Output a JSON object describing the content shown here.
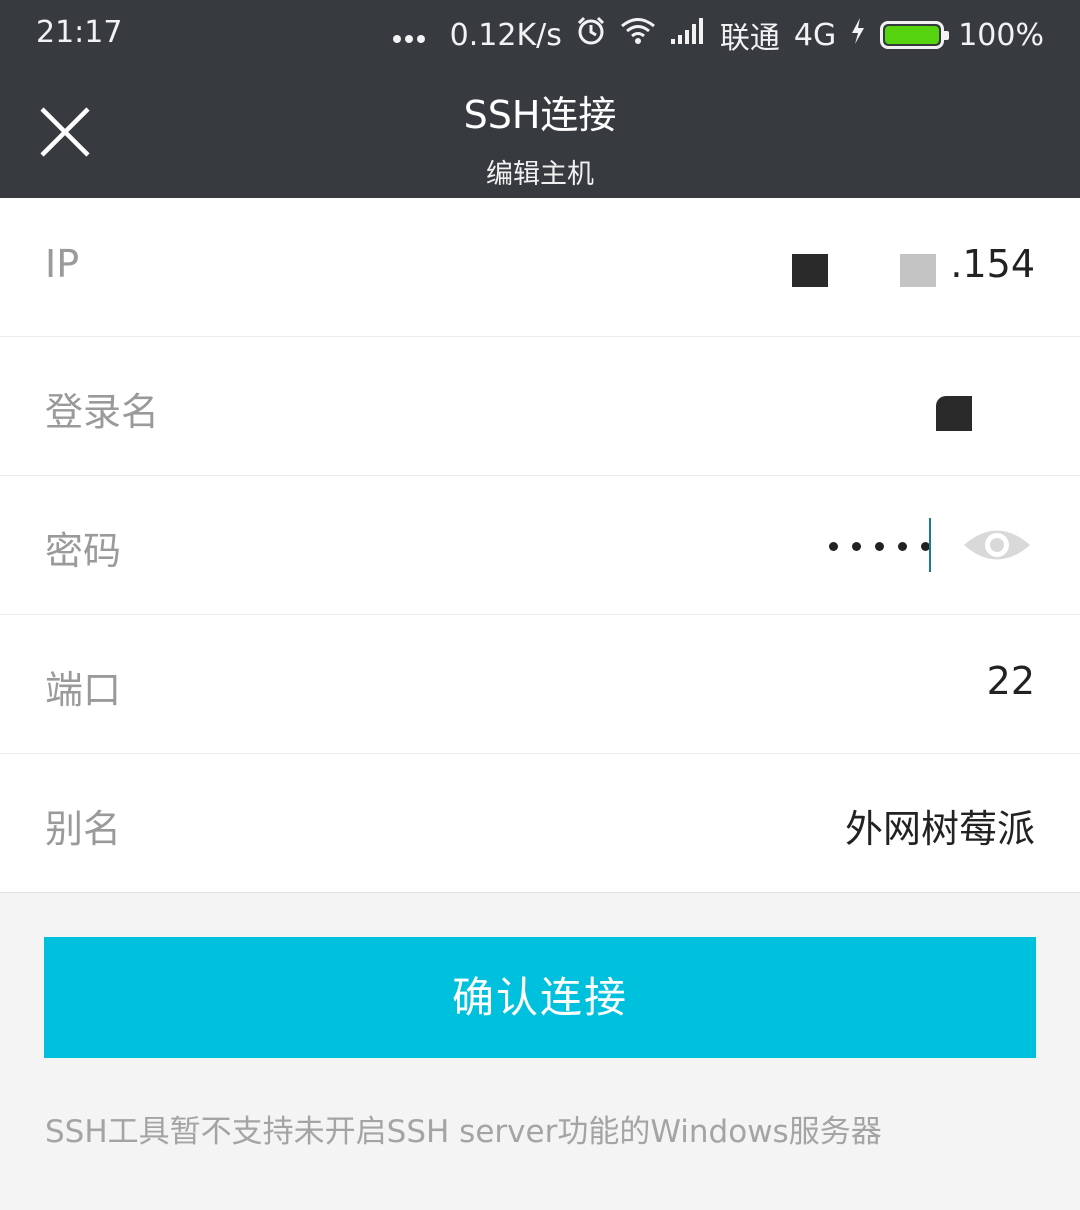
{
  "status_bar": {
    "time": "21:17",
    "net_speed": "0.12K/s",
    "carrier": "联通",
    "network": "4G",
    "battery": "100%",
    "battery_level": 1.0,
    "icons": [
      "more-dots-icon",
      "alarm-icon",
      "wifi-icon",
      "signal-icon",
      "charging-icon",
      "battery-icon"
    ]
  },
  "header": {
    "title": "SSH连接",
    "subtitle": "编辑主机",
    "close_icon": "close-icon"
  },
  "form": {
    "ip": {
      "label": "IP",
      "value_suffix": ".154"
    },
    "login": {
      "label": "登录名"
    },
    "password": {
      "label": "密码",
      "masked_count": 5,
      "toggle_icon": "eye-icon"
    },
    "port": {
      "label": "端口",
      "value": "22"
    },
    "alias": {
      "label": "别名",
      "value": "外网树莓派"
    }
  },
  "actions": {
    "confirm_label": "确认连接"
  },
  "note": "SSH工具暂不支持未开启SSH server功能的Windows服务器",
  "colors": {
    "header_bg": "#373b40",
    "accent": "#00c1dd",
    "battery_fill": "#56d40f"
  }
}
